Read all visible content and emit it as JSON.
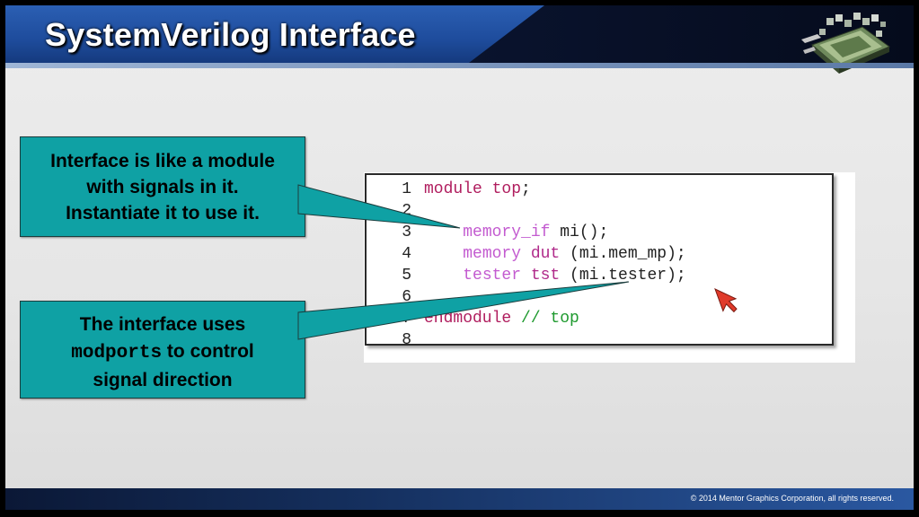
{
  "header": {
    "title": "SystemVerilog Interface"
  },
  "callouts": {
    "top": {
      "line1": "Interface is like a module",
      "line2": "with signals in it.",
      "line3": "Instantiate it to use it."
    },
    "bottom": {
      "line1": "The interface uses",
      "line2_code": "modports",
      "line2_rest": " to control",
      "line3": "signal direction"
    }
  },
  "code": {
    "lines": [
      {
        "num": "1",
        "indent": "",
        "a": "module",
        "b": " top",
        "c": ";",
        "d": ""
      },
      {
        "num": "2",
        "indent": "",
        "a": "",
        "b": "",
        "c": "",
        "d": ""
      },
      {
        "num": "3",
        "indent": "    ",
        "a": "memory_if",
        "b": " mi",
        "c": "();",
        "d": ""
      },
      {
        "num": "4",
        "indent": "    ",
        "a": "memory",
        "b": " dut",
        "c": " (mi.mem_mp);",
        "d": ""
      },
      {
        "num": "5",
        "indent": "    ",
        "a": "tester",
        "b": " tst",
        "c": " (mi.tester);",
        "d": ""
      },
      {
        "num": "6",
        "indent": "",
        "a": "",
        "b": "",
        "c": "",
        "d": ""
      },
      {
        "num": "7",
        "indent": "",
        "a": "endmodule",
        "b": "",
        "c": "",
        "d": " // top"
      },
      {
        "num": "8",
        "indent": "",
        "a": "",
        "b": "",
        "c": "",
        "d": ""
      }
    ]
  },
  "footer": {
    "copyright": "© 2014 Mentor Graphics Corporation, all rights reserved."
  },
  "colors": {
    "callout_fill": "#0fa1a4",
    "keyword": "#b01d5e",
    "type": "#c35bd0",
    "comment": "#1f9a2f",
    "cursor": "#e03a2a"
  },
  "icons": {
    "logo": "chip-logo-icon",
    "cursor": "arrow-cursor-icon"
  }
}
